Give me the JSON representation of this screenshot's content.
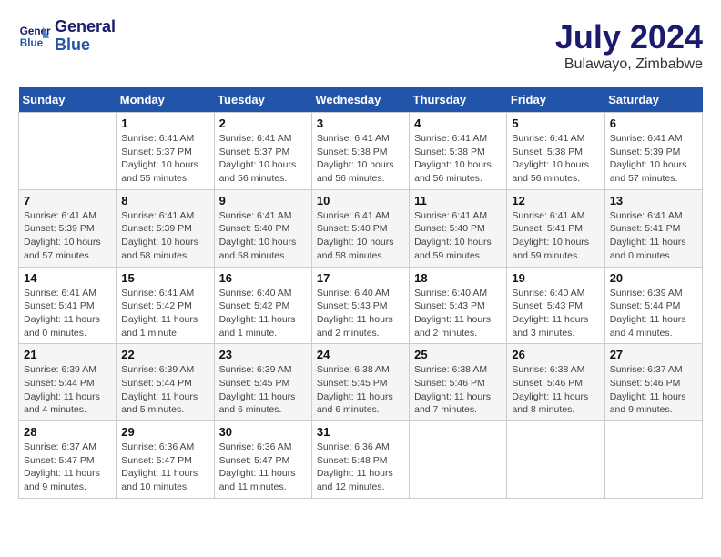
{
  "header": {
    "logo_line1": "General",
    "logo_line2": "Blue",
    "title": "July 2024",
    "subtitle": "Bulawayo, Zimbabwe"
  },
  "weekdays": [
    "Sunday",
    "Monday",
    "Tuesday",
    "Wednesday",
    "Thursday",
    "Friday",
    "Saturday"
  ],
  "weeks": [
    [
      {
        "num": "",
        "detail": ""
      },
      {
        "num": "1",
        "detail": "Sunrise: 6:41 AM\nSunset: 5:37 PM\nDaylight: 10 hours\nand 55 minutes."
      },
      {
        "num": "2",
        "detail": "Sunrise: 6:41 AM\nSunset: 5:37 PM\nDaylight: 10 hours\nand 56 minutes."
      },
      {
        "num": "3",
        "detail": "Sunrise: 6:41 AM\nSunset: 5:38 PM\nDaylight: 10 hours\nand 56 minutes."
      },
      {
        "num": "4",
        "detail": "Sunrise: 6:41 AM\nSunset: 5:38 PM\nDaylight: 10 hours\nand 56 minutes."
      },
      {
        "num": "5",
        "detail": "Sunrise: 6:41 AM\nSunset: 5:38 PM\nDaylight: 10 hours\nand 56 minutes."
      },
      {
        "num": "6",
        "detail": "Sunrise: 6:41 AM\nSunset: 5:39 PM\nDaylight: 10 hours\nand 57 minutes."
      }
    ],
    [
      {
        "num": "7",
        "detail": "Sunrise: 6:41 AM\nSunset: 5:39 PM\nDaylight: 10 hours\nand 57 minutes."
      },
      {
        "num": "8",
        "detail": "Sunrise: 6:41 AM\nSunset: 5:39 PM\nDaylight: 10 hours\nand 58 minutes."
      },
      {
        "num": "9",
        "detail": "Sunrise: 6:41 AM\nSunset: 5:40 PM\nDaylight: 10 hours\nand 58 minutes."
      },
      {
        "num": "10",
        "detail": "Sunrise: 6:41 AM\nSunset: 5:40 PM\nDaylight: 10 hours\nand 58 minutes."
      },
      {
        "num": "11",
        "detail": "Sunrise: 6:41 AM\nSunset: 5:40 PM\nDaylight: 10 hours\nand 59 minutes."
      },
      {
        "num": "12",
        "detail": "Sunrise: 6:41 AM\nSunset: 5:41 PM\nDaylight: 10 hours\nand 59 minutes."
      },
      {
        "num": "13",
        "detail": "Sunrise: 6:41 AM\nSunset: 5:41 PM\nDaylight: 11 hours\nand 0 minutes."
      }
    ],
    [
      {
        "num": "14",
        "detail": "Sunrise: 6:41 AM\nSunset: 5:41 PM\nDaylight: 11 hours\nand 0 minutes."
      },
      {
        "num": "15",
        "detail": "Sunrise: 6:41 AM\nSunset: 5:42 PM\nDaylight: 11 hours\nand 1 minute."
      },
      {
        "num": "16",
        "detail": "Sunrise: 6:40 AM\nSunset: 5:42 PM\nDaylight: 11 hours\nand 1 minute."
      },
      {
        "num": "17",
        "detail": "Sunrise: 6:40 AM\nSunset: 5:43 PM\nDaylight: 11 hours\nand 2 minutes."
      },
      {
        "num": "18",
        "detail": "Sunrise: 6:40 AM\nSunset: 5:43 PM\nDaylight: 11 hours\nand 2 minutes."
      },
      {
        "num": "19",
        "detail": "Sunrise: 6:40 AM\nSunset: 5:43 PM\nDaylight: 11 hours\nand 3 minutes."
      },
      {
        "num": "20",
        "detail": "Sunrise: 6:39 AM\nSunset: 5:44 PM\nDaylight: 11 hours\nand 4 minutes."
      }
    ],
    [
      {
        "num": "21",
        "detail": "Sunrise: 6:39 AM\nSunset: 5:44 PM\nDaylight: 11 hours\nand 4 minutes."
      },
      {
        "num": "22",
        "detail": "Sunrise: 6:39 AM\nSunset: 5:44 PM\nDaylight: 11 hours\nand 5 minutes."
      },
      {
        "num": "23",
        "detail": "Sunrise: 6:39 AM\nSunset: 5:45 PM\nDaylight: 11 hours\nand 6 minutes."
      },
      {
        "num": "24",
        "detail": "Sunrise: 6:38 AM\nSunset: 5:45 PM\nDaylight: 11 hours\nand 6 minutes."
      },
      {
        "num": "25",
        "detail": "Sunrise: 6:38 AM\nSunset: 5:46 PM\nDaylight: 11 hours\nand 7 minutes."
      },
      {
        "num": "26",
        "detail": "Sunrise: 6:38 AM\nSunset: 5:46 PM\nDaylight: 11 hours\nand 8 minutes."
      },
      {
        "num": "27",
        "detail": "Sunrise: 6:37 AM\nSunset: 5:46 PM\nDaylight: 11 hours\nand 9 minutes."
      }
    ],
    [
      {
        "num": "28",
        "detail": "Sunrise: 6:37 AM\nSunset: 5:47 PM\nDaylight: 11 hours\nand 9 minutes."
      },
      {
        "num": "29",
        "detail": "Sunrise: 6:36 AM\nSunset: 5:47 PM\nDaylight: 11 hours\nand 10 minutes."
      },
      {
        "num": "30",
        "detail": "Sunrise: 6:36 AM\nSunset: 5:47 PM\nDaylight: 11 hours\nand 11 minutes."
      },
      {
        "num": "31",
        "detail": "Sunrise: 6:36 AM\nSunset: 5:48 PM\nDaylight: 11 hours\nand 12 minutes."
      },
      {
        "num": "",
        "detail": ""
      },
      {
        "num": "",
        "detail": ""
      },
      {
        "num": "",
        "detail": ""
      }
    ]
  ]
}
